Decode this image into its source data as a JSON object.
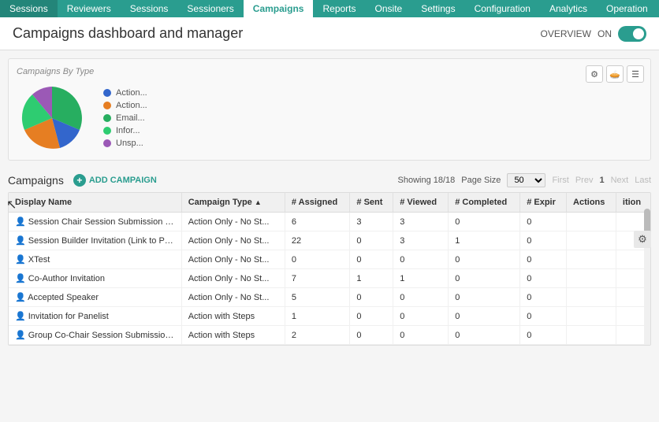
{
  "nav": {
    "items": [
      {
        "label": "Sessions",
        "active": false
      },
      {
        "label": "Reviewers",
        "active": false
      },
      {
        "label": "Sessions",
        "active": false
      },
      {
        "label": "Sessioners",
        "active": false
      },
      {
        "label": "Campaigns",
        "active": true
      },
      {
        "label": "Reports",
        "active": false
      },
      {
        "label": "Onsite",
        "active": false
      },
      {
        "label": "Settings",
        "active": false
      },
      {
        "label": "Configuration",
        "active": false
      },
      {
        "label": "Analytics",
        "active": false
      },
      {
        "label": "Operation",
        "active": false
      }
    ]
  },
  "header": {
    "title": "Campaigns dashboard and manager",
    "overview_label": "OVERVIEW",
    "toggle_state": "ON"
  },
  "chart": {
    "title": "Campaigns By Type",
    "legend": [
      {
        "label": "Action...",
        "color": "#3366cc"
      },
      {
        "label": "Action...",
        "color": "#e67e22"
      },
      {
        "label": "Email...",
        "color": "#27ae60"
      },
      {
        "label": "Infor...",
        "color": "#2ecc71"
      },
      {
        "label": "Unsp...",
        "color": "#9b59b6"
      }
    ]
  },
  "campaigns": {
    "title": "Campaigns",
    "add_label": "ADD CAMPAIGN",
    "showing": "Showing 18/18",
    "page_size_label": "Page Size",
    "page_size": "50",
    "first": "First",
    "prev": "Prev",
    "page": "1",
    "next": "Next",
    "last": "Last"
  },
  "table": {
    "columns": [
      "Display Name",
      "Campaign Type",
      "# Assigned",
      "# Sent",
      "# Viewed",
      "# Completed",
      "# Expir",
      "Actions",
      "ition"
    ],
    "rows": [
      {
        "name": "Session Chair Session Submission Editing",
        "type": "Action Only - No St...",
        "assigned": "6",
        "sent": "3",
        "viewed": "3",
        "completed": "0",
        "expir": "0"
      },
      {
        "name": "Session Builder Invitation (Link to Portal)",
        "type": "Action Only - No St...",
        "assigned": "22",
        "sent": "0",
        "viewed": "3",
        "completed": "1",
        "expir": "0"
      },
      {
        "name": "XTest",
        "type": "Action Only - No St...",
        "assigned": "0",
        "sent": "0",
        "viewed": "0",
        "completed": "0",
        "expir": "0"
      },
      {
        "name": "Co-Author Invitation",
        "type": "Action Only - No St...",
        "assigned": "7",
        "sent": "1",
        "viewed": "1",
        "completed": "0",
        "expir": "0"
      },
      {
        "name": "Accepted Speaker",
        "type": "Action Only - No St...",
        "assigned": "5",
        "sent": "0",
        "viewed": "0",
        "completed": "0",
        "expir": "0"
      },
      {
        "name": "Invitation for Panelist",
        "type": "Action with Steps",
        "assigned": "1",
        "sent": "0",
        "viewed": "0",
        "completed": "0",
        "expir": "0"
      },
      {
        "name": "Group Co-Chair Session Submission View",
        "type": "Action with Steps",
        "assigned": "2",
        "sent": "0",
        "viewed": "0",
        "completed": "0",
        "expir": "0"
      }
    ]
  }
}
